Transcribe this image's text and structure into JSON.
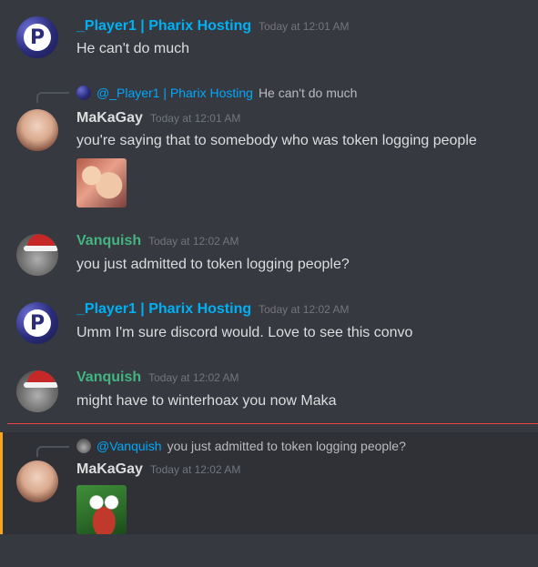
{
  "colors": {
    "player1": "#00b0f4",
    "vanquish": "#43b581",
    "makagay": "#dcddde",
    "reply_name": "#00a8fc",
    "new_divider": "#ed4245",
    "mention_bar": "#faa61a"
  },
  "messages": [
    {
      "author": "_Player1 | Pharix Hosting",
      "timestamp": "Today at 12:01 AM",
      "text": "He can't do much",
      "avatar": "pharix-avatar"
    },
    {
      "reply_to": {
        "author": "@_Player1 | Pharix Hosting",
        "text": "He can't do much"
      },
      "author": "MaKaGay",
      "timestamp": "Today at 12:01 AM",
      "text": "you're saying that to somebody who was token logging people",
      "attachment": "meme-image",
      "avatar": "makagay-avatar"
    },
    {
      "author": "Vanquish",
      "timestamp": "Today at 12:02 AM",
      "text": "you just admitted to token logging people?",
      "avatar": "vanquish-avatar"
    },
    {
      "author": "_Player1 | Pharix Hosting",
      "timestamp": "Today at 12:02 AM",
      "text": "Umm I'm sure discord would. Love to see this convo",
      "avatar": "pharix-avatar"
    },
    {
      "author": "Vanquish",
      "timestamp": "Today at 12:02 AM",
      "text": "might have to winterhoax you now Maka",
      "avatar": "vanquish-avatar"
    },
    {
      "reply_to": {
        "author": "@Vanquish",
        "text": "you just admitted to token logging people?"
      },
      "author": "MaKaGay",
      "timestamp": "Today at 12:02 AM",
      "text": "",
      "attachment": "pepe-image",
      "avatar": "makagay-avatar"
    }
  ]
}
